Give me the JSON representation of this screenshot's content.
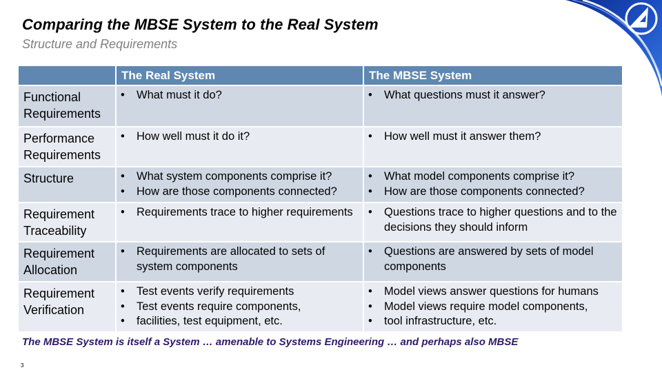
{
  "slide": {
    "title": "Comparing the MBSE System to the Real System",
    "subtitle": "Structure and Requirements",
    "footer_note": "The MBSE System is itself a System … amenable to Systems Engineering … and perhaps also MBSE",
    "page_number": "3",
    "logo_icon": "circled-a-logo",
    "colors": {
      "header_bg": "#5f87b1",
      "row_dark": "#cfd7e3",
      "row_light": "#e8ebf1",
      "footer_text": "#2e1a6b",
      "subtitle_text": "#7f7f7f"
    }
  },
  "table": {
    "headers": [
      "",
      "The Real System",
      "The MBSE System"
    ],
    "bullet_glyph": "•",
    "rows": [
      {
        "label": "Functional Requirements",
        "real": [
          "What must it do?"
        ],
        "mbse": [
          "What questions must it answer?"
        ]
      },
      {
        "label": "Performance Requirements",
        "real": [
          "How well must it do it?"
        ],
        "mbse": [
          "How well must it answer them?"
        ]
      },
      {
        "label": "Structure",
        "real": [
          "What system components comprise it?",
          "How are those components connected?"
        ],
        "mbse": [
          "What model components comprise it?",
          "How are those components connected?"
        ]
      },
      {
        "label": "Requirement Traceability",
        "real": [
          "Requirements trace to higher requirements"
        ],
        "mbse": [
          "Questions trace to higher questions and to the decisions they should inform"
        ]
      },
      {
        "label": "Requirement Allocation",
        "real": [
          "Requirements are allocated to sets of system components"
        ],
        "mbse": [
          "Questions are answered by sets of model components"
        ]
      },
      {
        "label": "Requirement Verification",
        "real": [
          "Test events verify requirements",
          "Test events require components,",
          "facilities, test equipment, etc."
        ],
        "mbse": [
          "Model views answer questions for humans",
          "Model views require model components,",
          "tool infrastructure, etc."
        ]
      }
    ]
  }
}
